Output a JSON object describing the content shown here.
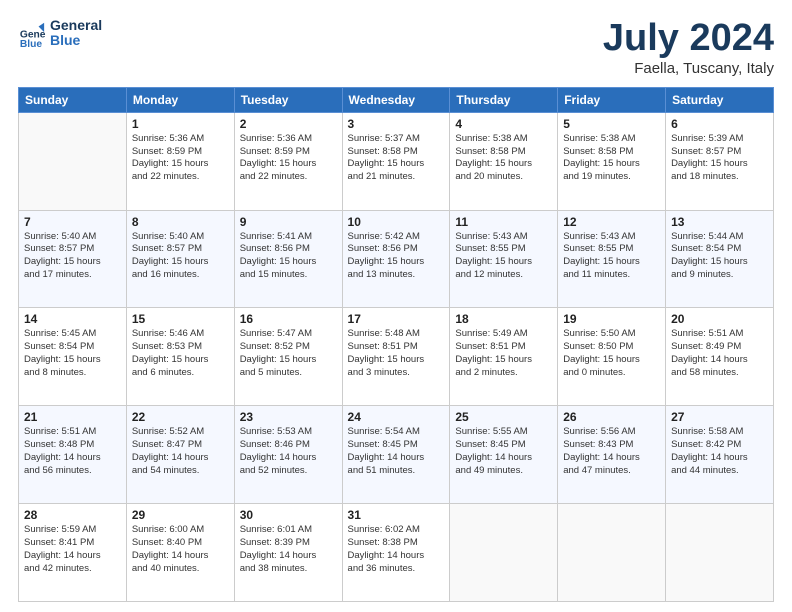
{
  "logo": {
    "line1": "General",
    "line2": "Blue"
  },
  "title": "July 2024",
  "subtitle": "Faella, Tuscany, Italy",
  "days_header": [
    "Sunday",
    "Monday",
    "Tuesday",
    "Wednesday",
    "Thursday",
    "Friday",
    "Saturday"
  ],
  "weeks": [
    [
      {
        "day": "",
        "info": ""
      },
      {
        "day": "1",
        "info": "Sunrise: 5:36 AM\nSunset: 8:59 PM\nDaylight: 15 hours\nand 22 minutes."
      },
      {
        "day": "2",
        "info": "Sunrise: 5:36 AM\nSunset: 8:59 PM\nDaylight: 15 hours\nand 22 minutes."
      },
      {
        "day": "3",
        "info": "Sunrise: 5:37 AM\nSunset: 8:58 PM\nDaylight: 15 hours\nand 21 minutes."
      },
      {
        "day": "4",
        "info": "Sunrise: 5:38 AM\nSunset: 8:58 PM\nDaylight: 15 hours\nand 20 minutes."
      },
      {
        "day": "5",
        "info": "Sunrise: 5:38 AM\nSunset: 8:58 PM\nDaylight: 15 hours\nand 19 minutes."
      },
      {
        "day": "6",
        "info": "Sunrise: 5:39 AM\nSunset: 8:57 PM\nDaylight: 15 hours\nand 18 minutes."
      }
    ],
    [
      {
        "day": "7",
        "info": "Sunrise: 5:40 AM\nSunset: 8:57 PM\nDaylight: 15 hours\nand 17 minutes."
      },
      {
        "day": "8",
        "info": "Sunrise: 5:40 AM\nSunset: 8:57 PM\nDaylight: 15 hours\nand 16 minutes."
      },
      {
        "day": "9",
        "info": "Sunrise: 5:41 AM\nSunset: 8:56 PM\nDaylight: 15 hours\nand 15 minutes."
      },
      {
        "day": "10",
        "info": "Sunrise: 5:42 AM\nSunset: 8:56 PM\nDaylight: 15 hours\nand 13 minutes."
      },
      {
        "day": "11",
        "info": "Sunrise: 5:43 AM\nSunset: 8:55 PM\nDaylight: 15 hours\nand 12 minutes."
      },
      {
        "day": "12",
        "info": "Sunrise: 5:43 AM\nSunset: 8:55 PM\nDaylight: 15 hours\nand 11 minutes."
      },
      {
        "day": "13",
        "info": "Sunrise: 5:44 AM\nSunset: 8:54 PM\nDaylight: 15 hours\nand 9 minutes."
      }
    ],
    [
      {
        "day": "14",
        "info": "Sunrise: 5:45 AM\nSunset: 8:54 PM\nDaylight: 15 hours\nand 8 minutes."
      },
      {
        "day": "15",
        "info": "Sunrise: 5:46 AM\nSunset: 8:53 PM\nDaylight: 15 hours\nand 6 minutes."
      },
      {
        "day": "16",
        "info": "Sunrise: 5:47 AM\nSunset: 8:52 PM\nDaylight: 15 hours\nand 5 minutes."
      },
      {
        "day": "17",
        "info": "Sunrise: 5:48 AM\nSunset: 8:51 PM\nDaylight: 15 hours\nand 3 minutes."
      },
      {
        "day": "18",
        "info": "Sunrise: 5:49 AM\nSunset: 8:51 PM\nDaylight: 15 hours\nand 2 minutes."
      },
      {
        "day": "19",
        "info": "Sunrise: 5:50 AM\nSunset: 8:50 PM\nDaylight: 15 hours\nand 0 minutes."
      },
      {
        "day": "20",
        "info": "Sunrise: 5:51 AM\nSunset: 8:49 PM\nDaylight: 14 hours\nand 58 minutes."
      }
    ],
    [
      {
        "day": "21",
        "info": "Sunrise: 5:51 AM\nSunset: 8:48 PM\nDaylight: 14 hours\nand 56 minutes."
      },
      {
        "day": "22",
        "info": "Sunrise: 5:52 AM\nSunset: 8:47 PM\nDaylight: 14 hours\nand 54 minutes."
      },
      {
        "day": "23",
        "info": "Sunrise: 5:53 AM\nSunset: 8:46 PM\nDaylight: 14 hours\nand 52 minutes."
      },
      {
        "day": "24",
        "info": "Sunrise: 5:54 AM\nSunset: 8:45 PM\nDaylight: 14 hours\nand 51 minutes."
      },
      {
        "day": "25",
        "info": "Sunrise: 5:55 AM\nSunset: 8:45 PM\nDaylight: 14 hours\nand 49 minutes."
      },
      {
        "day": "26",
        "info": "Sunrise: 5:56 AM\nSunset: 8:43 PM\nDaylight: 14 hours\nand 47 minutes."
      },
      {
        "day": "27",
        "info": "Sunrise: 5:58 AM\nSunset: 8:42 PM\nDaylight: 14 hours\nand 44 minutes."
      }
    ],
    [
      {
        "day": "28",
        "info": "Sunrise: 5:59 AM\nSunset: 8:41 PM\nDaylight: 14 hours\nand 42 minutes."
      },
      {
        "day": "29",
        "info": "Sunrise: 6:00 AM\nSunset: 8:40 PM\nDaylight: 14 hours\nand 40 minutes."
      },
      {
        "day": "30",
        "info": "Sunrise: 6:01 AM\nSunset: 8:39 PM\nDaylight: 14 hours\nand 38 minutes."
      },
      {
        "day": "31",
        "info": "Sunrise: 6:02 AM\nSunset: 8:38 PM\nDaylight: 14 hours\nand 36 minutes."
      },
      {
        "day": "",
        "info": ""
      },
      {
        "day": "",
        "info": ""
      },
      {
        "day": "",
        "info": ""
      }
    ]
  ]
}
